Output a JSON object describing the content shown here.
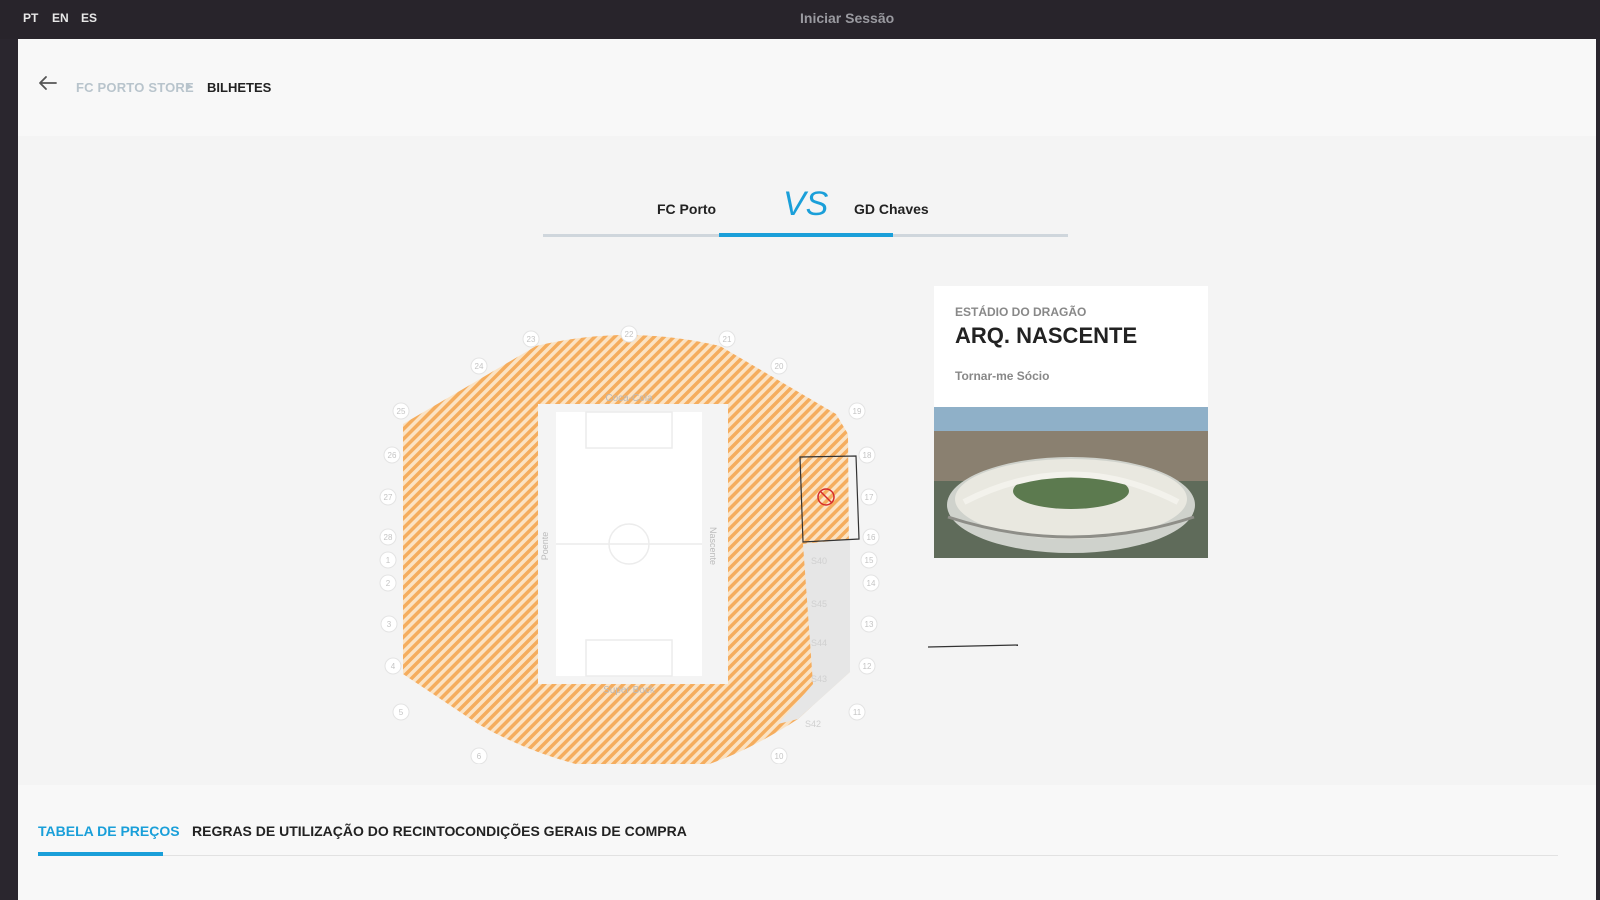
{
  "topbar": {
    "languages": [
      "PT",
      "EN",
      "ES"
    ],
    "login_label": "Iniciar Sessão"
  },
  "breadcrumb": {
    "items": [
      "FC PORTO STORE",
      "BILHETES"
    ]
  },
  "match": {
    "home_team": "FC Porto",
    "vs_label": "VS",
    "away_team": "GD Chaves"
  },
  "stadium_map": {
    "sponsor_north": "Coca-Cola",
    "sponsor_south": "Super Bock",
    "stand_west": "Poente",
    "stand_east": "Nascente",
    "gate_numbers": [
      "22",
      "21",
      "20",
      "19",
      "18",
      "17",
      "16",
      "15",
      "14",
      "13",
      "12",
      "11",
      "10",
      "9",
      "8",
      "7",
      "6",
      "5",
      "4",
      "3",
      "2",
      "1",
      "28",
      "27",
      "26",
      "25",
      "24",
      "23"
    ],
    "unavailable_sections": [
      "S40",
      "S45",
      "S44",
      "S43",
      "S42"
    ],
    "colors": {
      "available_stripes": "#f5ad5e",
      "unavailable": "#e6e6e6",
      "selection": "#333333",
      "blocked_marker": "#d62b2b"
    }
  },
  "venue_card": {
    "subtitle": "ESTÁDIO DO DRAGÃO",
    "title": "ARQ. NASCENTE",
    "link_label": "Tornar-me Sócio",
    "photo_icon": "stadium-photo"
  },
  "tabs": {
    "items": [
      "TABELA DE PREÇOS",
      "REGRAS DE UTILIZAÇÃO DO RECINTO",
      "CONDIÇÕES GERAIS DE COMPRA"
    ],
    "active_index": 0
  },
  "colors": {
    "accent": "#1a9fd9",
    "topbar": "#28242b"
  }
}
